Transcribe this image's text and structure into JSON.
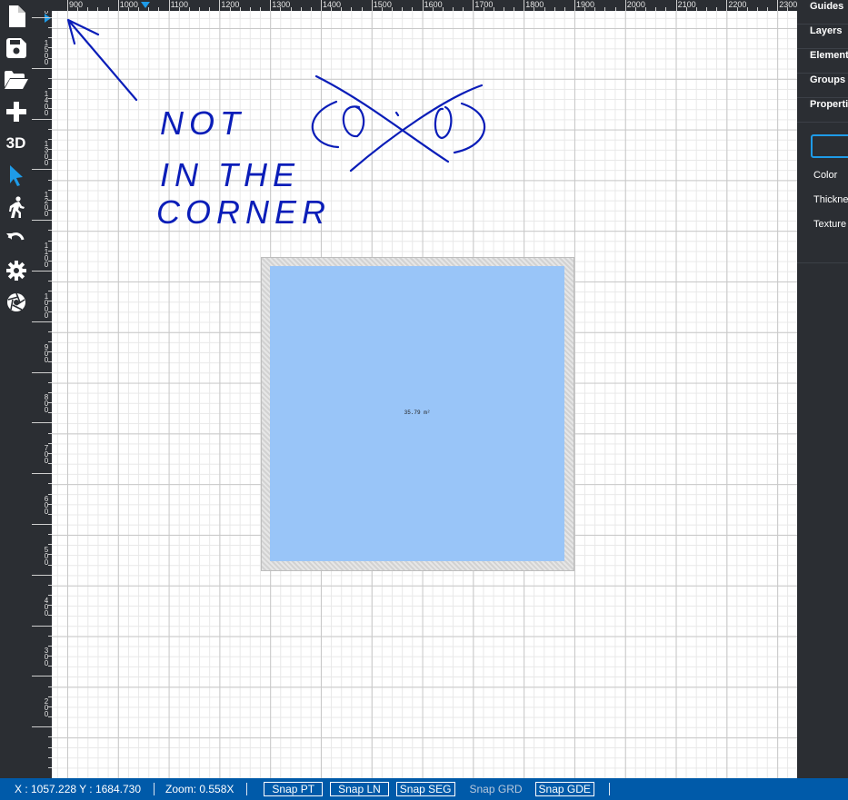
{
  "toolbar": {
    "three_d_label": "3D"
  },
  "ruler": {
    "top_labels": [
      "900",
      "1000",
      "1100",
      "1200",
      "1300",
      "1400",
      "1500",
      "1600",
      "1700",
      "1800",
      "1900",
      "2000",
      "2100",
      "2200",
      "2300"
    ],
    "left_labels": [
      "1600",
      "1500",
      "1400",
      "1300",
      "1200",
      "1100",
      "1000",
      "900",
      "800",
      "700",
      "600",
      "500",
      "400",
      "300",
      "200"
    ]
  },
  "canvas": {
    "area_label": "35.79 m²"
  },
  "annotation": {
    "line1": "NOT",
    "line2": "IN THE",
    "line3": "CORNER",
    "crossed": "(0,0)"
  },
  "right_panel": {
    "tabs": [
      "Guides",
      "Layers",
      "Elements",
      "Groups",
      "Properties"
    ],
    "properties": {
      "color_label": "Color",
      "thickness_label": "Thickness",
      "texture_label": "Texture"
    }
  },
  "status": {
    "coords": "X : 1057.228 Y : 1684.730",
    "zoom": "Zoom: 0.558X",
    "snap_pt": "Snap PT",
    "snap_ln": "Snap LN",
    "snap_seg": "Snap SEG",
    "snap_grd": "Snap GRD",
    "snap_gde": "Snap GDE"
  },
  "colors": {
    "toolbar_bg": "#2b2e33",
    "accent": "#1e9be8",
    "statusbar_bg": "#005aa9",
    "floor": "#99c5f8",
    "ink": "#0a1db8"
  }
}
